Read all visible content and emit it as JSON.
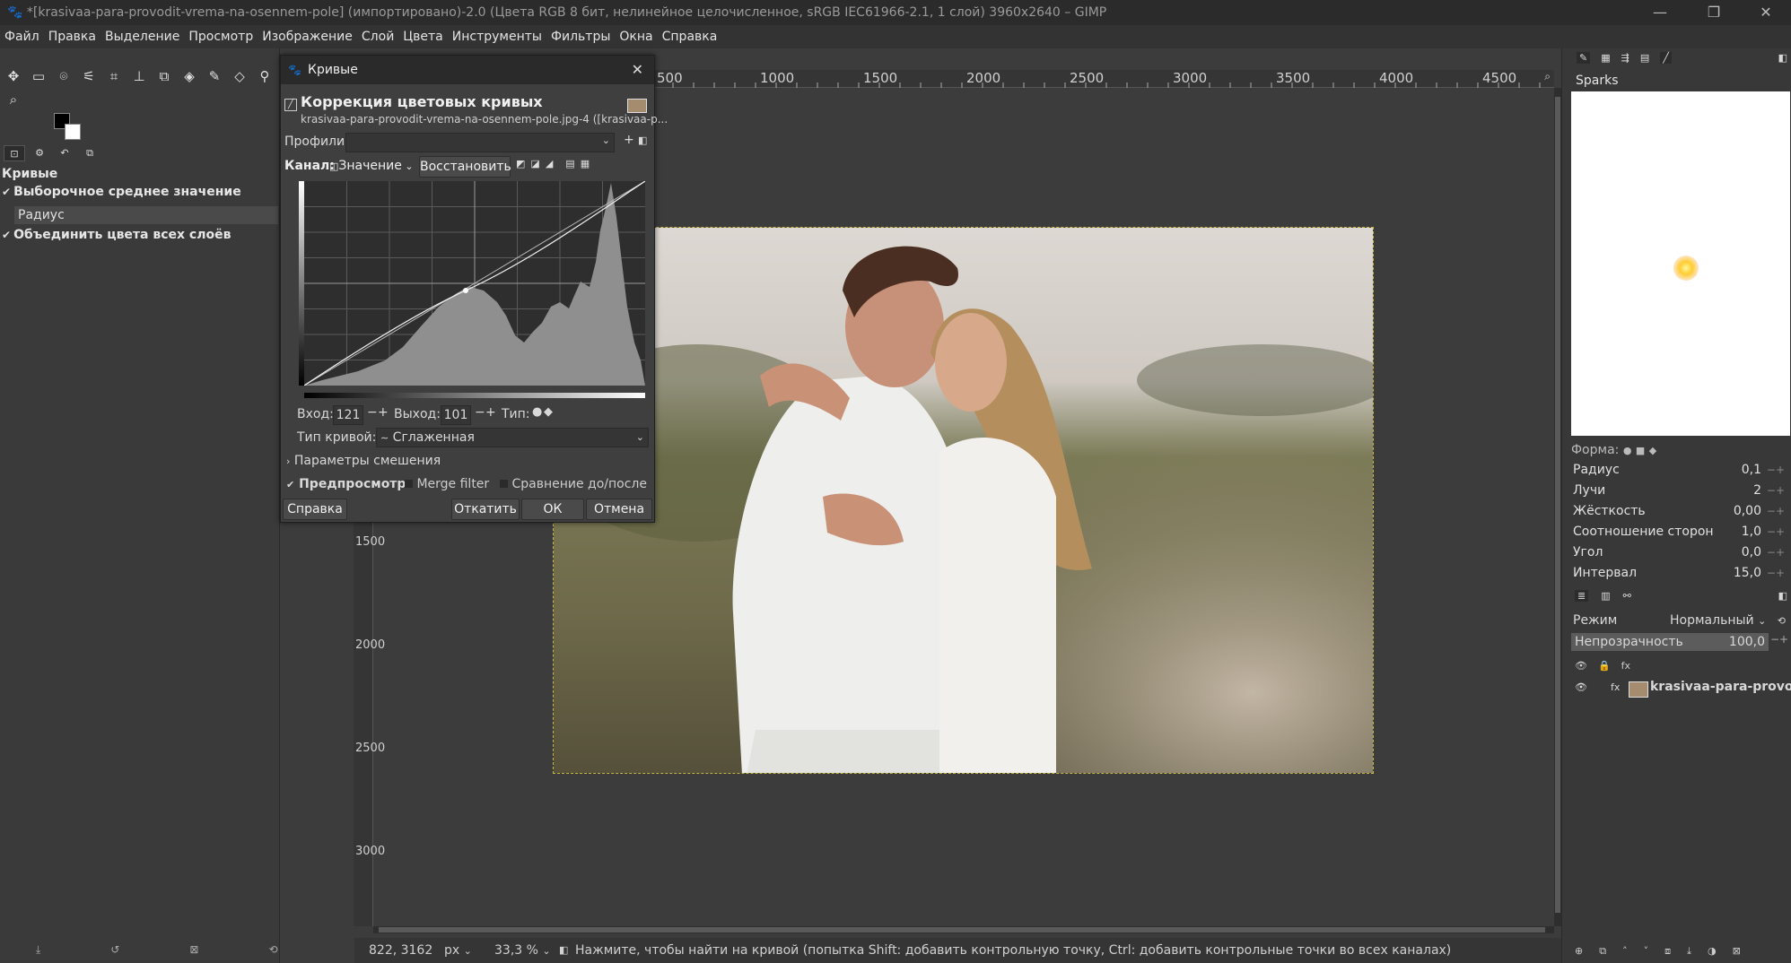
{
  "window": {
    "title": "*[krasivaa-para-provodit-vrema-na-osennem-pole] (импортировано)-2.0 (Цвета RGB 8 бит, нелинейное целочисленное, sRGB IEC61966-2.1, 1 слой) 3960x2640 – GIMP"
  },
  "menu": [
    "Файл",
    "Правка",
    "Выделение",
    "Просмотр",
    "Изображение",
    "Слой",
    "Цвета",
    "Инструменты",
    "Фильтры",
    "Окна",
    "Справка"
  ],
  "tool_options": {
    "title": "Кривые",
    "opt1": "Выборочное среднее значение",
    "radius_label": "Радиус",
    "opt2": "Объединить цвета всех слоёв"
  },
  "ruler": {
    "h_labels": [
      "500",
      "1000",
      "1500",
      "2000",
      "2500",
      "3000",
      "3500",
      "4000",
      "4500"
    ],
    "v_labels": [
      "1500",
      "2000",
      "2500",
      "3000"
    ]
  },
  "dialog": {
    "title": "Кривые",
    "heading": "Коррекция цветовых кривых",
    "subheading": "krasivaa-para-provodit-vrema-na-osennem-pole.jpg-4 ([krasivaa-p...",
    "profiles_label": "Профили:",
    "channel_label": "Канал:",
    "channel_value": "Значение",
    "reset_label": "Восстановить",
    "input_label": "Вход:",
    "input_value": "121",
    "output_label": "Выход:",
    "output_value": "101",
    "type_label": "Тип:",
    "curve_type_label": "Тип кривой:",
    "curve_type_value": "Сглаженная",
    "blend_label": "Параметры смешения",
    "preview_label": "Предпросмотр",
    "merge_label": "Merge filter",
    "compare_label": "Сравнение до/после",
    "help_btn": "Справка",
    "reset_btn": "Откатить",
    "ok_btn": "ОК",
    "cancel_btn": "Отмена"
  },
  "brushes": {
    "title": "Sparks",
    "shape_label": "Форма:",
    "params": [
      {
        "label": "Радиус",
        "value": "0,1"
      },
      {
        "label": "Лучи",
        "value": "2"
      },
      {
        "label": "Жёсткость",
        "value": "0,00"
      },
      {
        "label": "Соотношение сторон",
        "value": "1,0"
      },
      {
        "label": "Угол",
        "value": "0,0"
      },
      {
        "label": "Интервал",
        "value": "15,0"
      }
    ]
  },
  "layers": {
    "mode_label": "Режим",
    "mode_value": "Нормальный",
    "opacity_label": "Непрозрачность",
    "opacity_value": "100,0",
    "layer_name": "krasivaa-para-provod"
  },
  "status": {
    "coords": "822, 3162",
    "unit": "px",
    "zoom": "33,3 %",
    "message": "Нажмите, чтобы найти на кривой (попытка Shift: добавить контрольную точку, Ctrl: добавить контрольные точки во всех каналах)"
  },
  "colors": {
    "accent": "#c8b640",
    "bg": "#3c3c3c"
  }
}
